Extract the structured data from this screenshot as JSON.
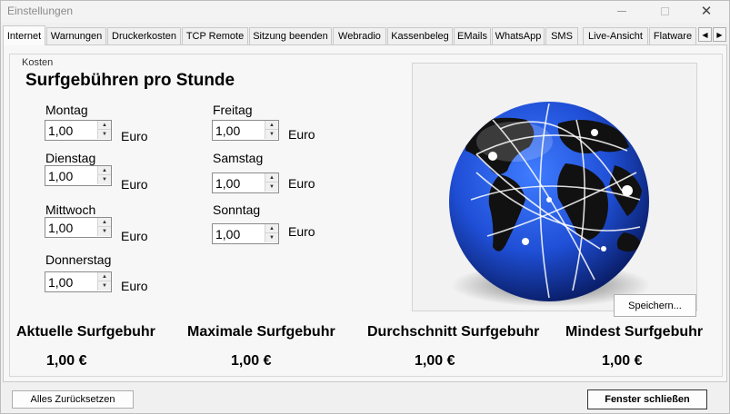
{
  "window": {
    "title": "Einstellungen"
  },
  "tabs": [
    "Internet",
    "Warnungen",
    "Druckerkosten",
    "TCP Remote",
    "Sitzung beenden",
    "Webradio",
    "Kassenbeleg",
    "EMails",
    "WhatsApp",
    "SMS",
    "Live-Ansicht",
    "Flatware"
  ],
  "active_tab": "Internet",
  "group": {
    "label": "Kosten",
    "heading": "Surfgebühren pro Stunde"
  },
  "currency_unit": "Euro",
  "days": [
    {
      "label": "Montag",
      "value": "1,00"
    },
    {
      "label": "Dienstag",
      "value": "1,00"
    },
    {
      "label": "Mittwoch",
      "value": "1,00"
    },
    {
      "label": "Donnerstag",
      "value": "1,00"
    },
    {
      "label": "Freitag",
      "value": "1,00"
    },
    {
      "label": "Samstag",
      "value": "1,00"
    },
    {
      "label": "Sonntag",
      "value": "1,00"
    }
  ],
  "save_button": "Speichern...",
  "stats": [
    {
      "title": "Aktuelle Surfgebuhr",
      "value": "1,00 €"
    },
    {
      "title": "Maximale Surfgebuhr",
      "value": "1,00 €"
    },
    {
      "title": "Durchschnitt Surfgebuhr",
      "value": "1,00 €"
    },
    {
      "title": "Mindest Surfgebuhr",
      "value": "1,00 €"
    }
  ],
  "footer": {
    "reset_button": "Alles Zurücksetzen",
    "close_button": "Fenster schließen"
  },
  "icons": {
    "globe": "globe-network-icon",
    "minimize": "minimize-icon",
    "maximize": "maximize-icon",
    "close": "close-icon",
    "scroll_left": "arrow-left-icon",
    "scroll_right": "arrow-right-icon"
  },
  "colors": {
    "globe_ocean": "#1f4fd6",
    "globe_land": "#1a1a1a"
  }
}
